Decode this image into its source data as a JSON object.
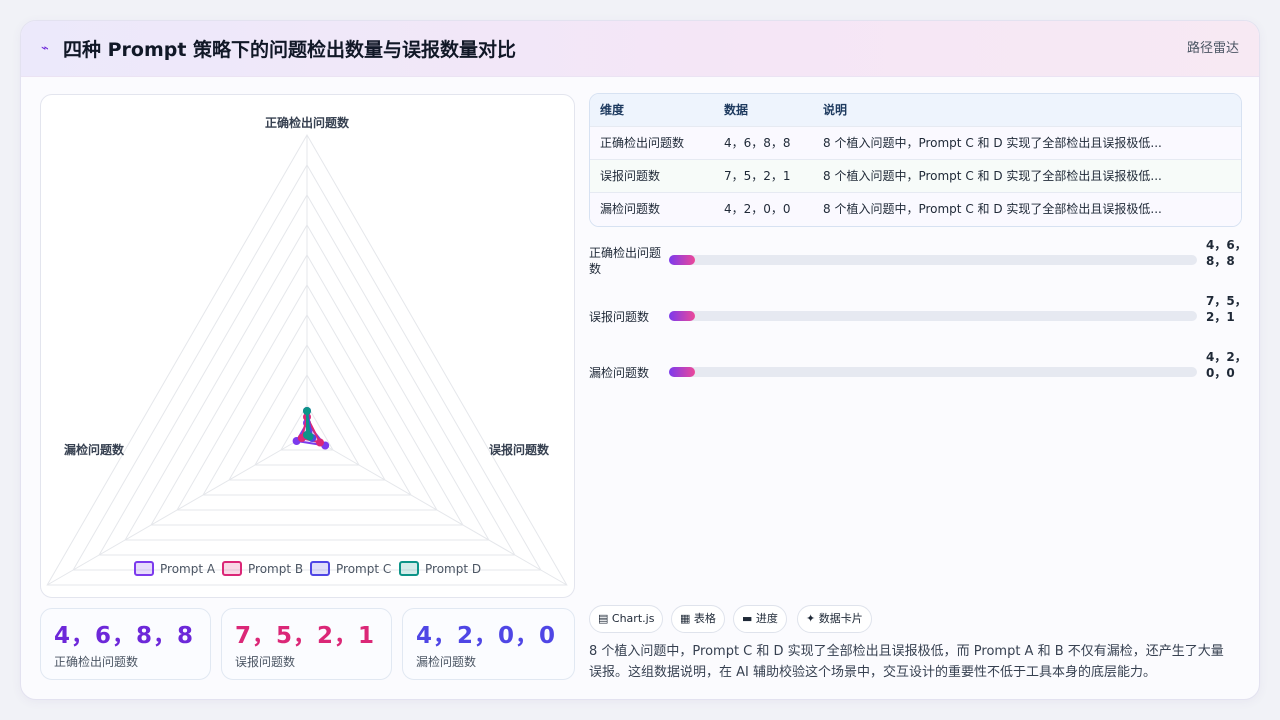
{
  "header": {
    "icon": "pulse-icon",
    "title": "四种 Prompt 策略下的问题检出数量与误报数量对比",
    "right_label": "路径雷达"
  },
  "colors": {
    "accent": "#6d28d9",
    "series": [
      "#7c3aed",
      "#db2777",
      "#4f46e5",
      "#0d9488"
    ]
  },
  "chart_data": {
    "type": "radar",
    "axes": [
      "正确检出问题数",
      "误报问题数",
      "漏检问题数"
    ],
    "series": [
      {
        "name": "Prompt A",
        "values": [
          4,
          7,
          4
        ]
      },
      {
        "name": "Prompt B",
        "values": [
          6,
          5,
          2
        ]
      },
      {
        "name": "Prompt C",
        "values": [
          8,
          2,
          0
        ]
      },
      {
        "name": "Prompt D",
        "values": [
          8,
          1,
          0
        ]
      }
    ],
    "rmax": 100,
    "grid_levels": 10,
    "legend_position": "bottom"
  },
  "stats": [
    {
      "value": "4，6，8，8",
      "label": "正确检出问题数",
      "color": "#6d28d9"
    },
    {
      "value": "7，5，2，1",
      "label": "误报问题数",
      "color": "#db2777"
    },
    {
      "value": "4，2，0，0",
      "label": "漏检问题数",
      "color": "#4f46e5"
    }
  ],
  "table": {
    "headers": [
      "维度",
      "数据",
      "说明"
    ],
    "rows": [
      [
        "正确检出问题数",
        "4，6，8，8",
        "8 个植入问题中，Prompt C 和 D 实现了全部检出且误报极低..."
      ],
      [
        "误报问题数",
        "7，5，2，1",
        "8 个植入问题中，Prompt C 和 D 实现了全部检出且误报极低..."
      ],
      [
        "漏检问题数",
        "4，2，0，0",
        "8 个植入问题中，Prompt C 和 D 实现了全部检出且误报极低..."
      ]
    ]
  },
  "progress": [
    {
      "label": "正确检出问题数",
      "value": "4，6，8，8",
      "fill_fraction": 0.05
    },
    {
      "label": "误报问题数",
      "value": "7，5，2，1",
      "fill_fraction": 0.05
    },
    {
      "label": "漏检问题数",
      "value": "4，2，0，0",
      "fill_fraction": 0.05
    }
  ],
  "tags": [
    {
      "icon": "chart-icon",
      "glyph": "▤",
      "label": "Chart.js"
    },
    {
      "icon": "table-icon",
      "glyph": "▦",
      "label": "表格"
    },
    {
      "icon": "progress-icon",
      "glyph": "▬",
      "label": "进度"
    },
    {
      "icon": "sparkle-icon",
      "glyph": "✦",
      "label": "数据卡片"
    }
  ],
  "summary": "8 个植入问题中，Prompt C 和 D 实现了全部检出且误报极低，而 Prompt A 和 B 不仅有漏检，还产生了大量误报。这组数据说明，在 AI 辅助校验这个场景中，交互设计的重要性不低于工具本身的底层能力。"
}
